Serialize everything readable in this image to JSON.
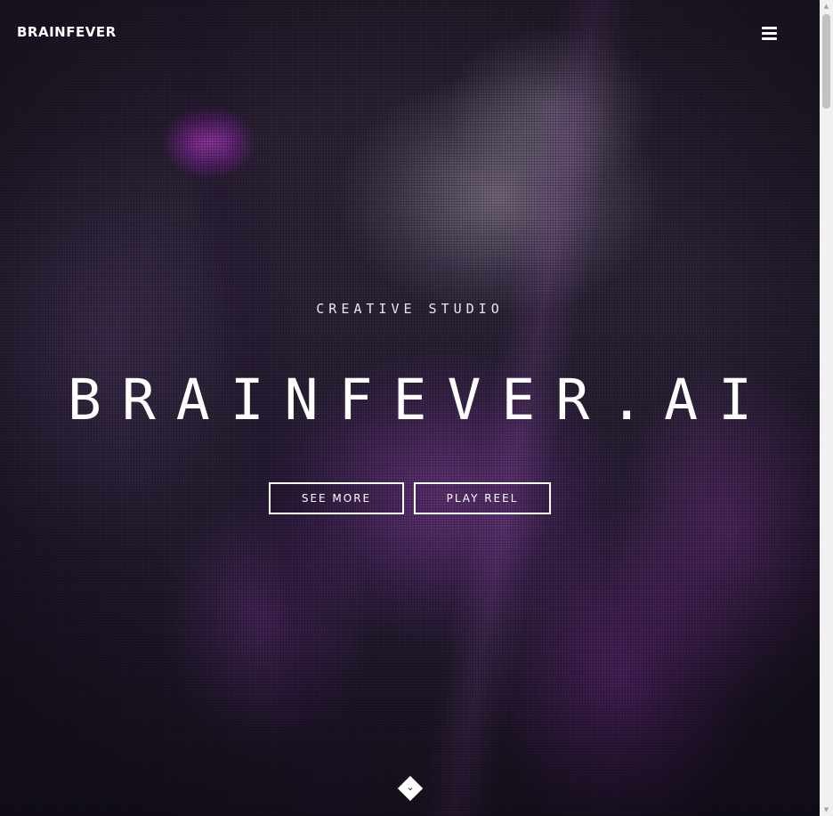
{
  "header": {
    "brand": "BRAINFEVER",
    "menu_icon": "hamburger-menu-icon"
  },
  "hero": {
    "subtitle": "CREATIVE STUDIO",
    "title": "BRAINFEVER.AI",
    "buttons": {
      "see_more": "SEE MORE",
      "play_reel": "PLAY REEL"
    },
    "scroll_icon": "chevron-down-icon",
    "scroll_glyph": "⌄"
  },
  "scrollbar": {
    "up_glyph": "▲",
    "down_glyph": "▼"
  },
  "colors": {
    "text": "#ffffff",
    "accent": "#b14fd0"
  }
}
